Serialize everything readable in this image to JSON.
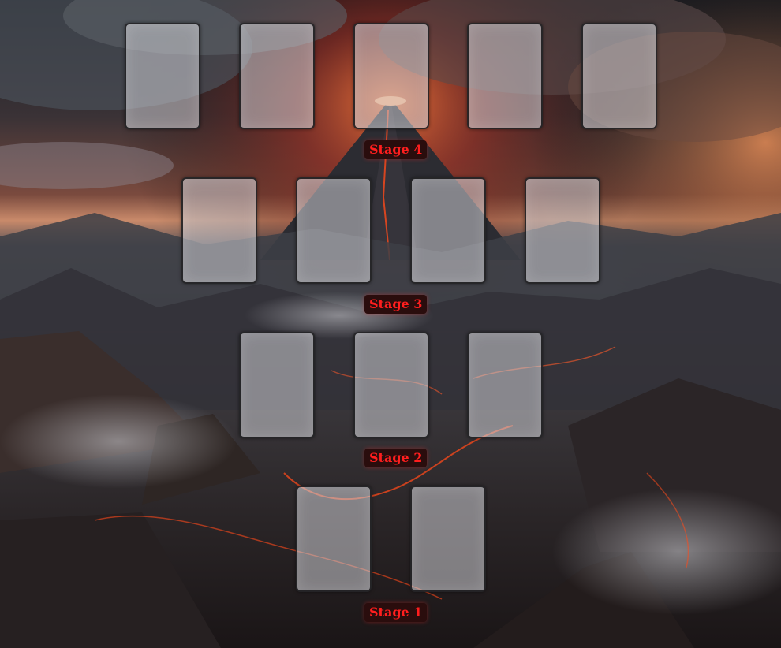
{
  "board": {
    "stages": [
      {
        "label": "Stage 4",
        "card_count": 5
      },
      {
        "label": "Stage 3",
        "card_count": 4
      },
      {
        "label": "Stage 2",
        "card_count": 3
      },
      {
        "label": "Stage 1",
        "card_count": 2
      }
    ]
  },
  "colors": {
    "label_text": "#ff1e1e",
    "label_bg": "#2a0d0d",
    "lava": "#ff4a1a"
  }
}
